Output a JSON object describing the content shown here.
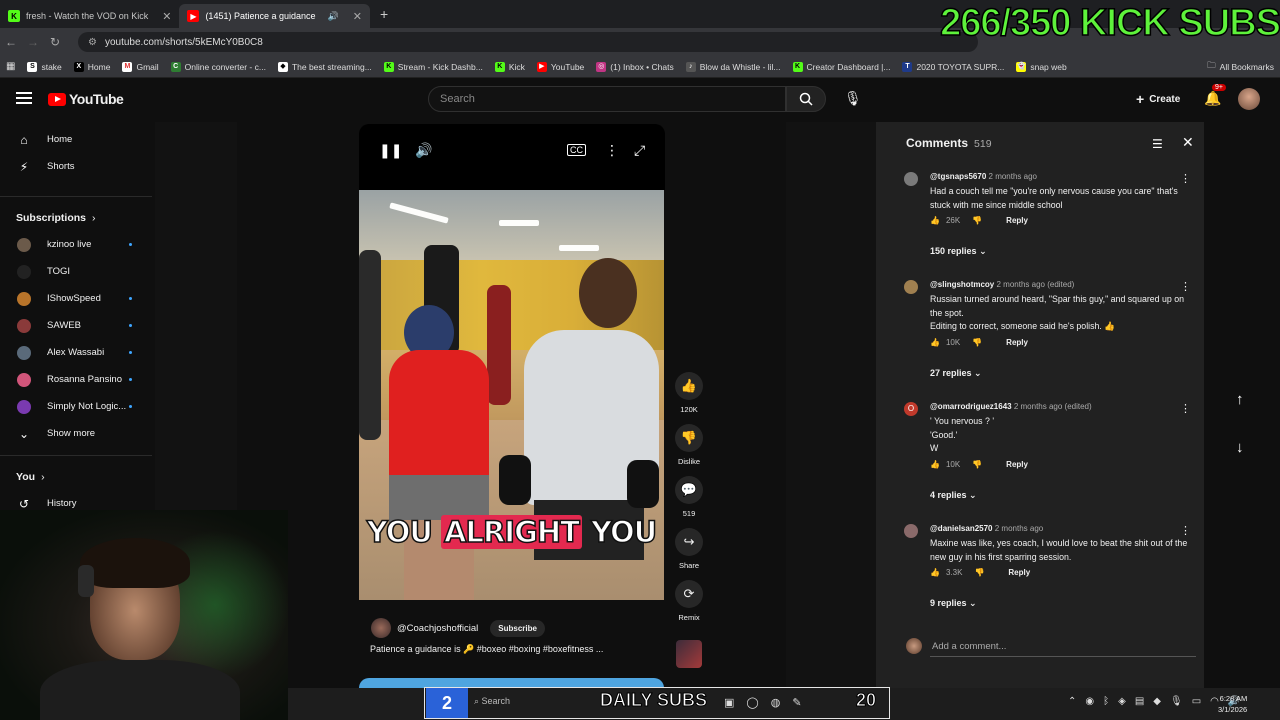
{
  "browser": {
    "tabs": [
      {
        "label": "fresh - Watch the VOD on Kick",
        "icon": "kick-icon",
        "color": "#53fc18"
      },
      {
        "label": "(1451) Patience a guidance",
        "icon": "youtube-icon",
        "color": "#ff0000"
      }
    ],
    "url": "youtube.com/shorts/5kEMcY0B0C8",
    "bookmarks": [
      {
        "label": "stake"
      },
      {
        "label": "Home"
      },
      {
        "label": "Gmail"
      },
      {
        "label": "Online converter - c..."
      },
      {
        "label": "The best streaming..."
      },
      {
        "label": "Stream - Kick Dashb..."
      },
      {
        "label": "Kick"
      },
      {
        "label": "YouTube"
      },
      {
        "label": "(1) Inbox • Chats"
      },
      {
        "label": "Blow da Whistle - lil..."
      },
      {
        "label": "Creator Dashboard |..."
      },
      {
        "label": "2020 TOYOTA SUPR..."
      },
      {
        "label": "snap web"
      }
    ],
    "all_bookmarks": "All Bookmarks"
  },
  "stream_overlay": {
    "subs_goal": "266/350 KICK SUBS",
    "daily_label": "DAILY SUBS",
    "daily_count": "2",
    "daily_count_right": "20"
  },
  "header": {
    "logo": "YouTube",
    "search_placeholder": "Search",
    "create": "Create",
    "notifications": "9+"
  },
  "sidebar": {
    "main": [
      {
        "label": "Home",
        "icon": "home-icon"
      },
      {
        "label": "Shorts",
        "icon": "shorts-icon"
      }
    ],
    "subscriptions_title": "Subscriptions",
    "subscriptions": [
      {
        "label": "kzinoo live",
        "color": "#6b5a4a"
      },
      {
        "label": "TOGI",
        "color": "#222"
      },
      {
        "label": "IShowSpeed",
        "color": "#b8742a"
      },
      {
        "label": "SAWEB",
        "color": "#8a3a3a"
      },
      {
        "label": "Alex Wassabi",
        "color": "#5a6a7a"
      },
      {
        "label": "Rosanna Pansino",
        "color": "#d1557a"
      },
      {
        "label": "Simply Not Logic...",
        "color": "#7a3ab0"
      }
    ],
    "show_more": "Show more",
    "you_title": "You",
    "history": "History"
  },
  "video": {
    "caption_a": "YOU ",
    "caption_b": "ALRIGHT",
    "caption_c": " YOU",
    "channel": "@Coachjoshofficial",
    "subscribe": "Subscribe",
    "description": "Patience a guidance is 🔑 #boxeo #boxing #boxefitness ..."
  },
  "actions": {
    "likes": "120K",
    "dislike": "Dislike",
    "comments": "519",
    "share": "Share",
    "remix": "Remix"
  },
  "comments": {
    "title": "Comments",
    "count": "519",
    "items": [
      {
        "author": "@tgsnaps5670",
        "time": "2 months ago",
        "text": "Had a couch tell me \"you're only nervous cause you care\" that's stuck with me since middle school",
        "likes": "26K",
        "replies": "150 replies",
        "color": "#7a7a7a"
      },
      {
        "author": "@slingshotmcoy",
        "time": "2 months ago (edited)",
        "text": "Russian turned around heard, \"Spar this guy,\" and squared up on the spot.\nEditing to correct, someone said he's polish. 👍",
        "likes": "10K",
        "replies": "27 replies",
        "color": "#a08050"
      },
      {
        "author": "@omarrodriguez1643",
        "time": "2 months ago (edited)",
        "text": "' You nervous ? '\n'Good.'\nW",
        "likes": "10K",
        "replies": "4 replies",
        "color": "#c0392b"
      },
      {
        "author": "@danielsan2570",
        "time": "2 months ago",
        "text": "Maxine was like, yes coach, I would love to beat the shit out of the new guy in his first sparring session.",
        "likes": "3.3K",
        "replies": "9 replies",
        "color": "#8a6a6a"
      }
    ],
    "reply_label": "Reply",
    "add_comment": "Add a comment..."
  },
  "taskbar": {
    "search": "Search",
    "time": "6:28 AM",
    "date": "3/1/2026"
  }
}
